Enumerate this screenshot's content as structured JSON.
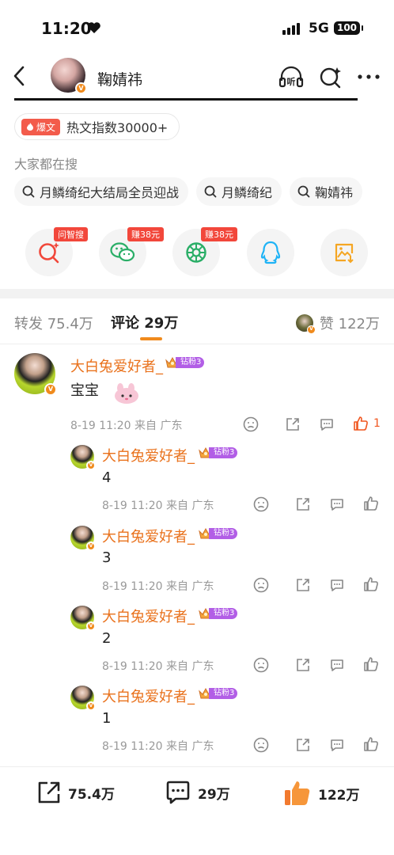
{
  "status": {
    "time": "11:20",
    "network": "5G",
    "battery": "100"
  },
  "nav": {
    "title": "鞠婧祎",
    "listen_label": "听"
  },
  "hot": {
    "tag": "爆文",
    "text": "热文指数30000+"
  },
  "search": {
    "title": "大家都在搜",
    "chips": [
      "月鳞绮纪大结局全员迎战",
      "月鳞绮纪",
      "鞠婧祎"
    ]
  },
  "share": {
    "items": [
      {
        "icon": "ask-search-icon",
        "tag": "问智搜",
        "color": "#f1473a"
      },
      {
        "icon": "wechat-icon",
        "tag": "赚38元",
        "color": "#2aae67"
      },
      {
        "icon": "moments-icon",
        "tag": "赚38元",
        "color": "#2aae67"
      },
      {
        "icon": "qq-icon",
        "tag": "",
        "color": "#1eb3f6"
      },
      {
        "icon": "save-image-icon",
        "tag": "",
        "color": "#f5a623"
      }
    ]
  },
  "tabs": {
    "repost": "转发 75.4万",
    "comment": "评论 29万",
    "likes": "赞 122万"
  },
  "comments": {
    "main": {
      "name": "大白兔爱好者_",
      "fan_level": "钻粉3",
      "text": "宝宝",
      "meta": "8-19 11:20 来自 广东",
      "like_count": "1"
    },
    "replies": [
      {
        "name": "大白兔爱好者_",
        "fan_level": "钻粉3",
        "text": "4",
        "meta": "8-19 11:20 来自 广东"
      },
      {
        "name": "大白兔爱好者_",
        "fan_level": "钻粉3",
        "text": "3",
        "meta": "8-19 11:20 来自 广东"
      },
      {
        "name": "大白兔爱好者_",
        "fan_level": "钻粉3",
        "text": "2",
        "meta": "8-19 11:20 来自 广东"
      },
      {
        "name": "大白兔爱好者_",
        "fan_level": "钻粉3",
        "text": "1",
        "meta": "8-19 11:20 来自 广东"
      }
    ]
  },
  "bottom": {
    "repost": "75.4万",
    "comment": "29万",
    "like": "122万"
  },
  "colors": {
    "accent": "#f08a1c",
    "name": "#e9711b",
    "like": "#f0561f",
    "fan_badge": "#b25ee6"
  }
}
